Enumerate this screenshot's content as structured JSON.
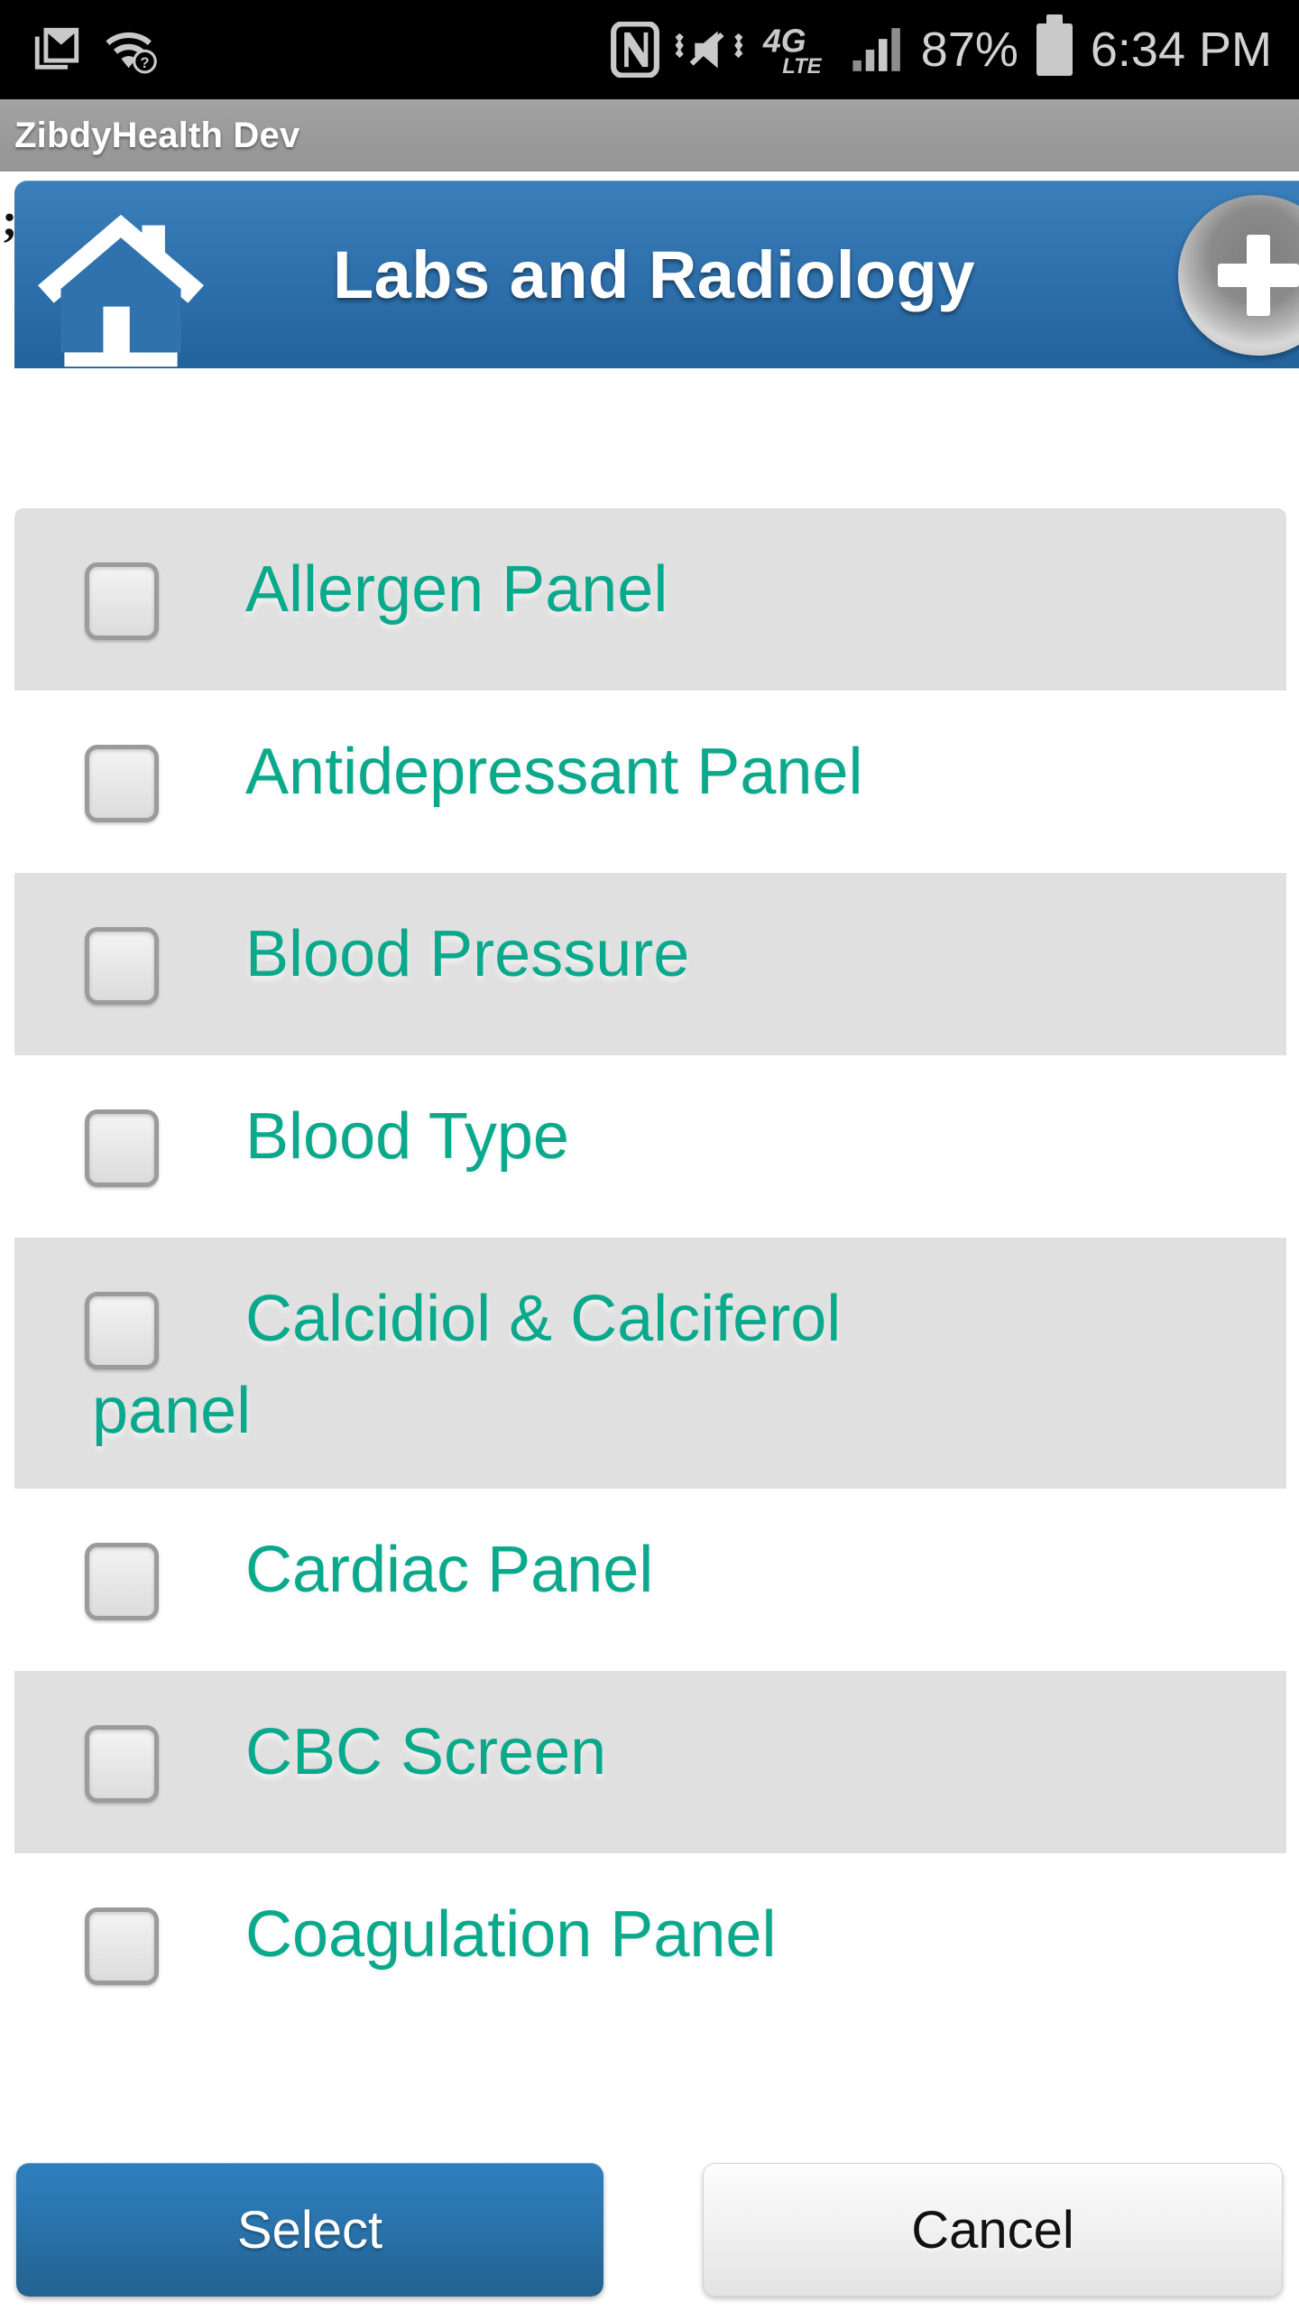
{
  "status_bar": {
    "icons_left": [
      "gmail-icon",
      "wifi-question-icon"
    ],
    "icons_right": [
      "nfc-icon",
      "mute-vibrate-icon",
      "4g-lte-icon",
      "signal-bars-icon"
    ],
    "network_label": "4G",
    "network_sub": "LTE",
    "battery_percent": "87%",
    "time": "6:34 PM",
    "background": "#000000",
    "foreground": "#d2d2d2"
  },
  "app_bar": {
    "title": "ZibdyHealth Dev"
  },
  "header": {
    "title": "Labs and Radiology",
    "home_icon": "home-icon",
    "add_icon": "plus-icon",
    "edge_artifact": ";",
    "background": "#2f72ae",
    "text_color": "#ffffff"
  },
  "list": {
    "accent_color": "#0aa98c",
    "row_odd_bg": "#e0e0e0",
    "row_even_bg": "#ffffff",
    "items": [
      {
        "label": "Allergen Panel",
        "checked": false,
        "wraps": false
      },
      {
        "label": "Antidepressant Panel",
        "checked": false,
        "wraps": false
      },
      {
        "label": "Blood Pressure",
        "checked": false,
        "wraps": false
      },
      {
        "label": "Blood Type",
        "checked": false,
        "wraps": false
      },
      {
        "label": "Calcidiol & Calciferol panel",
        "checked": false,
        "wraps": true,
        "line1": "Calcidiol & Calciferol",
        "line2": "panel"
      },
      {
        "label": "Cardiac Panel",
        "checked": false,
        "wraps": false
      },
      {
        "label": "CBC Screen",
        "checked": false,
        "wraps": false
      },
      {
        "label": "Coagulation Panel",
        "checked": false,
        "wraps": false
      }
    ]
  },
  "footer": {
    "select_label": "Select",
    "cancel_label": "Cancel",
    "select_color": "#2a74ae",
    "cancel_color": "#f2f2f2"
  }
}
